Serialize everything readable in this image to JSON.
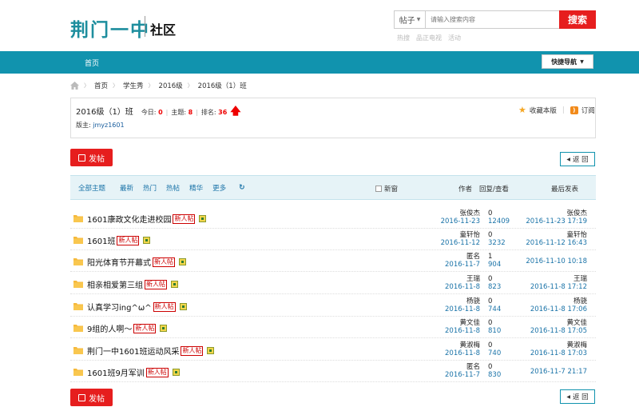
{
  "header": {
    "logo_text": "荆门一中",
    "logo_sub": "社区",
    "search_type": "帖子",
    "search_placeholder": "请输入搜索内容",
    "search_button": "搜索",
    "hot_links": [
      "热搜",
      "品正电视",
      "活动"
    ]
  },
  "nav": {
    "home": "首页",
    "quick_nav": "快捷导航"
  },
  "breadcrumb": [
    "首页",
    "学生秀",
    "2016级",
    "2016级（1）班"
  ],
  "forum": {
    "name": "2016级（1）班",
    "today_label": "今日:",
    "today": "0",
    "topics_label": "主题:",
    "topics": "8",
    "rank_label": "排名:",
    "rank": "36",
    "moderator_label": "版主:",
    "moderator": "jmyz1601",
    "favorite": "收藏本版",
    "subscribe": "订阅"
  },
  "actions": {
    "post": "发帖",
    "back": "返 回"
  },
  "table": {
    "tabs": [
      "全部主题",
      "最新",
      "热门",
      "热帖",
      "精华",
      "更多"
    ],
    "new_window": "新窗",
    "col_author": "作者",
    "col_reply": "回复/查看",
    "col_last": "最后发表"
  },
  "threads": [
    {
      "title": "1601康政文化走进校园",
      "is_new": true,
      "new_label": "新人帖",
      "author": "张俊杰",
      "date": "2016-11-23",
      "replies": "0",
      "views": "12409",
      "last_user": "张俊杰",
      "last_time": "2016-11-23 17:19"
    },
    {
      "title": "1601班",
      "is_new": true,
      "new_label": "新人帖",
      "author": "童轩怡",
      "date": "2016-11-12",
      "replies": "0",
      "views": "3232",
      "last_user": "童轩怡",
      "last_time": "2016-11-12 16:43"
    },
    {
      "title": "阳光体育节开幕式",
      "is_new": true,
      "new_label": "新人帖",
      "author": "匿名",
      "date": "2016-11-7",
      "replies": "1",
      "views": "904",
      "last_user": "",
      "last_time": "2016-11-10 10:18"
    },
    {
      "title": "相亲相爱第三组",
      "is_new": true,
      "new_label": "新人帖",
      "author": "王瑞",
      "date": "2016-11-8",
      "replies": "0",
      "views": "823",
      "last_user": "王瑞",
      "last_time": "2016-11-8 17:12"
    },
    {
      "title": "认真学习ing^ω^",
      "is_new": true,
      "new_label": "新人帖",
      "author": "杨骁",
      "date": "2016-11-8",
      "replies": "0",
      "views": "744",
      "last_user": "杨骁",
      "last_time": "2016-11-8 17:06"
    },
    {
      "title": "9组的人啊～",
      "is_new": true,
      "new_label": "新人帖",
      "author": "黄文佳",
      "date": "2016-11-8",
      "replies": "0",
      "views": "810",
      "last_user": "黄文佳",
      "last_time": "2016-11-8 17:05"
    },
    {
      "title": "荆门一中1601班运动风采",
      "is_new": true,
      "new_label": "新人帖",
      "author": "黄淑梅",
      "date": "2016-11-8",
      "replies": "0",
      "views": "740",
      "last_user": "黄淑梅",
      "last_time": "2016-11-8 17:03"
    },
    {
      "title": "1601班9月军训",
      "is_new": true,
      "new_label": "新人帖",
      "author": "匿名",
      "date": "2016-11-7",
      "replies": "0",
      "views": "830",
      "last_user": "",
      "last_time": "2016-11-7 21:17"
    }
  ],
  "colors": {
    "brand_teal": "#1193ae",
    "accent_red": "#e61e1e",
    "link_blue": "#1a73a8"
  }
}
